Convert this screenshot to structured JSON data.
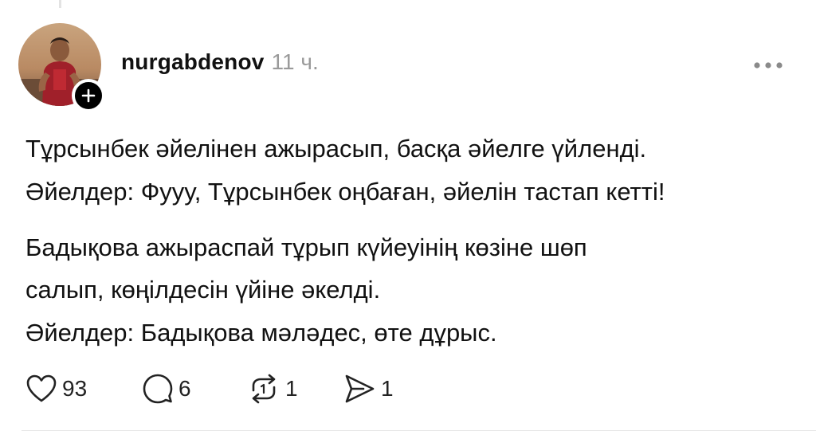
{
  "post": {
    "username": "nurgabdenov",
    "time": "11 ч.",
    "lines": [
      "Тұрсынбек әйелінен ажырасып, басқа әйелге үйленді.",
      "Әйелдер: Фууу, Тұрсынбек оңбаған, әйелін тастап кетті!",
      "Бадықова ажыраспай тұрып күйеуінің көзіне шөп",
      "салып, көңілдесін үйіне әкелді.",
      "Әйелдер: Бадықова мәләдес, өте дұрыс."
    ]
  },
  "actions": {
    "likes": "93",
    "comments": "6",
    "reposts": "1",
    "shares": "1"
  },
  "icons": {
    "follow": "plus-icon",
    "more": "more-icon",
    "like": "heart-icon",
    "comment": "comment-icon",
    "repost": "repost-icon",
    "share": "send-icon"
  },
  "colors": {
    "text": "#111111",
    "muted": "#9a9a9a",
    "badge": "#000000"
  }
}
